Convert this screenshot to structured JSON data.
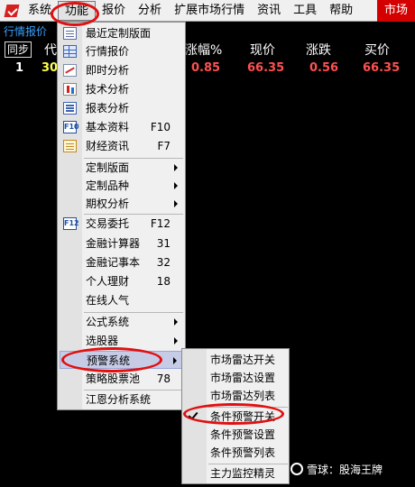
{
  "menubar": {
    "items": [
      "系统",
      "功能",
      "报价",
      "分析",
      "扩展市场行情",
      "资讯",
      "工具",
      "帮助"
    ],
    "right_label": "市场"
  },
  "tab": {
    "label": "行情报价"
  },
  "quote_header": {
    "sync": "同步",
    "code_partial": "代",
    "change_pct_partial": "涨幅%",
    "price": "现价",
    "change": "涨跌",
    "bid": "买价"
  },
  "quote_row": {
    "index": "1",
    "code_partial": "30",
    "change_pct": "0.85",
    "price": "66.35",
    "change": "0.56",
    "bid": "66.35"
  },
  "function_menu": {
    "items": [
      {
        "label": "最近定制版面",
        "shortcut": "",
        "icon": "doc-icon"
      },
      {
        "label": "行情报价",
        "shortcut": "",
        "icon": "grid-icon"
      },
      {
        "label": "即时分析",
        "shortcut": "",
        "icon": "line-chart-icon"
      },
      {
        "label": "技术分析",
        "shortcut": "",
        "icon": "candle-icon"
      },
      {
        "label": "报表分析",
        "shortcut": "",
        "icon": "report-icon"
      },
      {
        "label": "基本资料",
        "shortcut": "F10",
        "icon": "f10-icon"
      },
      {
        "label": "财经资讯",
        "shortcut": "F7",
        "icon": "news-icon"
      },
      {
        "label": "定制版面",
        "shortcut": "",
        "icon": ""
      },
      {
        "label": "定制品种",
        "shortcut": "",
        "icon": ""
      },
      {
        "label": "期权分析",
        "shortcut": "",
        "icon": ""
      },
      {
        "label": "交易委托",
        "shortcut": "F12",
        "icon": "f12-icon"
      },
      {
        "label": "金融计算器",
        "shortcut": "31",
        "icon": ""
      },
      {
        "label": "金融记事本",
        "shortcut": "32",
        "icon": ""
      },
      {
        "label": "个人理财",
        "shortcut": "18",
        "icon": ""
      },
      {
        "label": "在线人气",
        "shortcut": "",
        "icon": ""
      },
      {
        "label": "公式系统",
        "shortcut": "",
        "icon": ""
      },
      {
        "label": "选股器",
        "shortcut": "",
        "icon": ""
      },
      {
        "label": "预警系统",
        "shortcut": "",
        "icon": ""
      },
      {
        "label": "策略股票池",
        "shortcut": "78",
        "icon": ""
      },
      {
        "label": "江恩分析系统",
        "shortcut": "",
        "icon": ""
      }
    ],
    "fkey_icon_text": {
      "f10": "F10",
      "f12": "F12"
    }
  },
  "alert_submenu": {
    "items": [
      "市场雷达开关",
      "市场雷达设置",
      "市场雷达列表",
      "条件预警开关",
      "条件预警设置",
      "条件预警列表",
      "主力监控精灵"
    ],
    "checked": "条件预警开关"
  },
  "annotation_color": "#e01010",
  "accent_blue": "#3aa0ff",
  "quote_color_red": "#ff5050",
  "quote_color_yellow": "#ffff50",
  "watermark": "雪球：股海王牌"
}
